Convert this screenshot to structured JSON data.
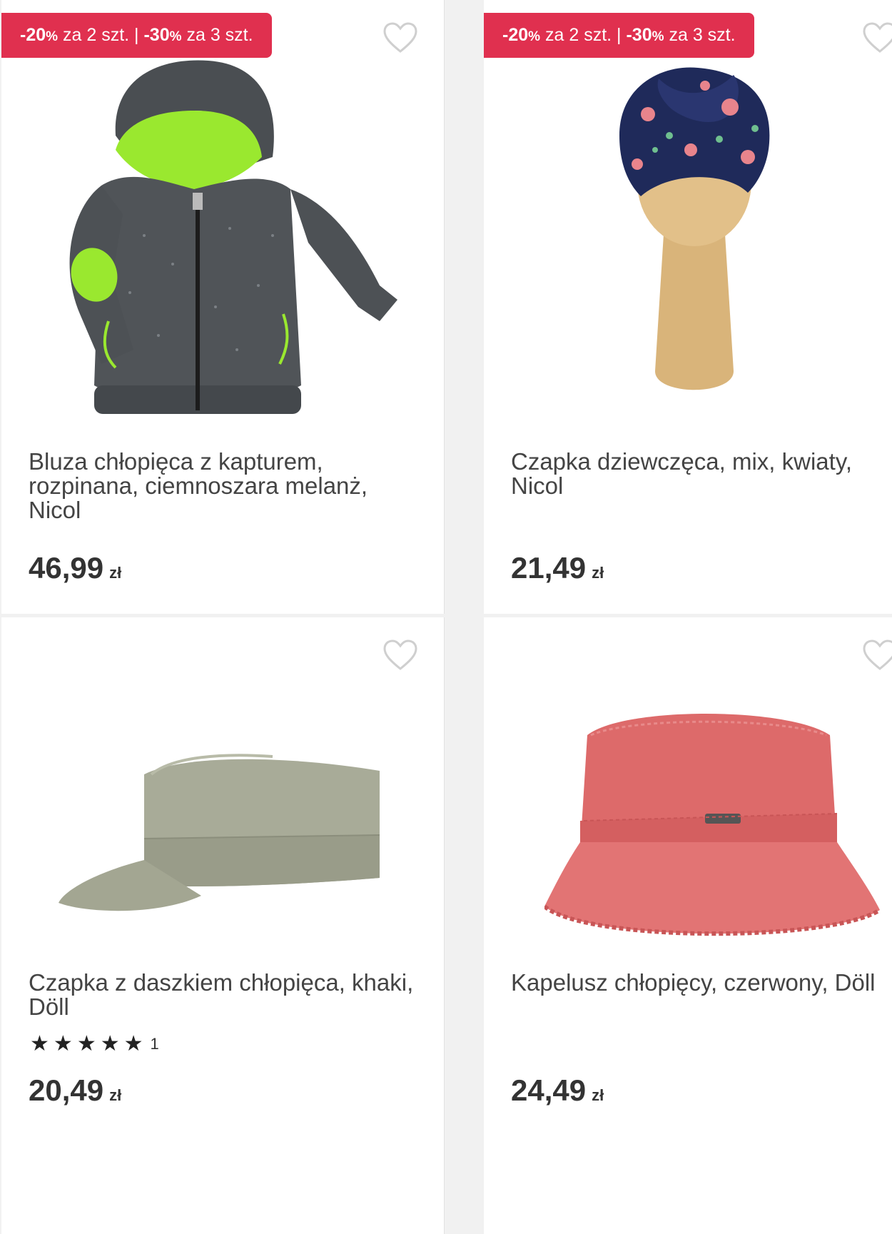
{
  "colors": {
    "promo_bg": "#e0304f",
    "card_bg": "#ffffff",
    "page_bg": "#f1f1f1"
  },
  "products": [
    {
      "promo": {
        "d1": "-20",
        "pct1": "%",
        "t1": " za 2 szt. | ",
        "d2": "-30",
        "pct2": "%",
        "t2": " za 3 szt."
      },
      "title": "Bluza chłopięca z kapturem, rozpinana, ciemnoszara melanż, Nicol",
      "price": "46,99",
      "currency": "zł",
      "image": "grey-zip-hoodie-with-green-hood"
    },
    {
      "promo": {
        "d1": "-20",
        "pct1": "%",
        "t1": " za 2 szt. | ",
        "d2": "-30",
        "pct2": "%",
        "t2": " za 3 szt."
      },
      "title": "Czapka dziewczęca, mix, kwiaty, Nicol",
      "price": "21,49",
      "currency": "zł",
      "image": "floral-turban-hat-on-wooden-stand"
    },
    {
      "title": "Czapka z daszkiem chłopięca, khaki, Döll",
      "rating": {
        "stars": 5,
        "count": "1"
      },
      "price": "20,49",
      "currency": "zł",
      "image": "khaki-military-cap"
    },
    {
      "title": "Kapelusz chłopięcy, czerwony, Döll",
      "price": "24,49",
      "currency": "zł",
      "image": "red-bucket-hat"
    }
  ]
}
